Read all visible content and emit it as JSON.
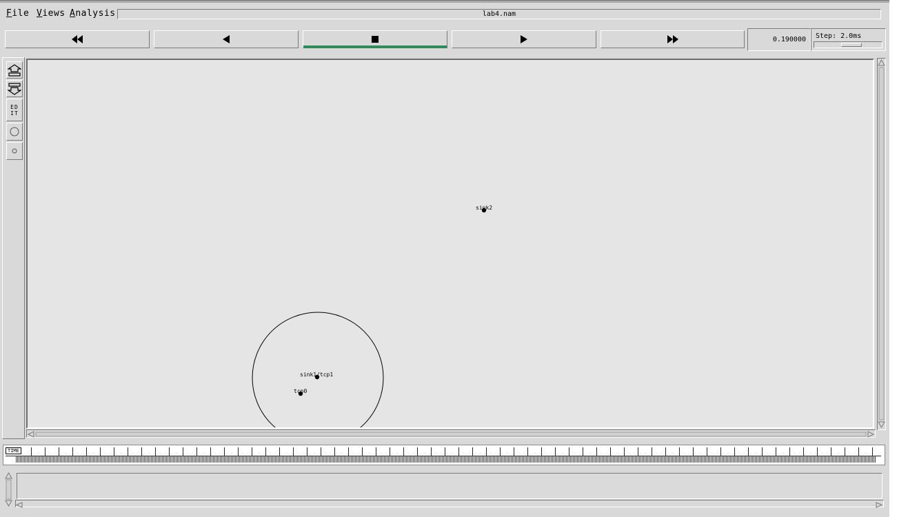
{
  "menu": {
    "file": {
      "accel": "F",
      "rest": "ile"
    },
    "views": {
      "accel": "V",
      "rest": "iews"
    },
    "analysis": {
      "accel": "A",
      "rest": "nalysis"
    }
  },
  "window": {
    "filename": "lab4.nam"
  },
  "controls": {
    "buttons": [
      {
        "name": "rewind-button",
        "icon": "fast-rewind-icon"
      },
      {
        "name": "backward-button",
        "icon": "play-backward-icon"
      },
      {
        "name": "stop-button",
        "icon": "stop-icon",
        "active": true
      },
      {
        "name": "play-button",
        "icon": "play-forward-icon"
      },
      {
        "name": "fast-forward-button",
        "icon": "fast-forward-icon"
      }
    ],
    "active_color": "#2e8b57",
    "time": "0.190000",
    "step": "Step: 2.0ms"
  },
  "tools": {
    "edit_top": "ED",
    "edit_bottom": "IT",
    "icons": [
      "zoom-in-icon",
      "zoom-out-icon",
      "edit-icon",
      "circle-node-icon",
      "small-node-icon"
    ]
  },
  "canvas": {
    "background": "#e5e5e5",
    "nodes": [
      {
        "id": "sink2",
        "label": "sink2"
      },
      {
        "id": "sink1",
        "label": "sink1/tcp1"
      },
      {
        "id": "tcp0",
        "label": "tcp0"
      }
    ]
  },
  "timeline": {
    "tag": "TIME"
  }
}
